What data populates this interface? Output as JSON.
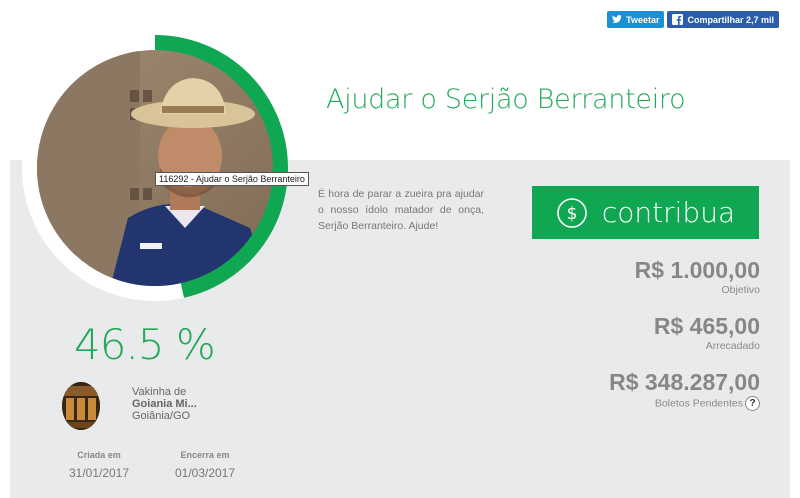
{
  "share": {
    "tweet_label": "Tweetar",
    "share_label": "Compartilhar 2,7 mil"
  },
  "campaign": {
    "title": "Ajudar o Serjão Berranteiro",
    "tooltip": "116292 - Ajudar o Serjão Berranteiro",
    "description": "É hora de parar a zueira pra ajudar o nosso ídolo matador de onça, Serjão Berranteiro. Ajude!",
    "contribute_label": "contribua",
    "progress_percent": 46.5,
    "percent_label": "46.5 %"
  },
  "stats": {
    "goal_amount": "R$ 1.000,00",
    "goal_label": "Objetivo",
    "raised_amount": "R$ 465,00",
    "raised_label": "Arrecadado",
    "pending_amount": "R$ 348.287,00",
    "pending_label": "Boletos Pendentes",
    "help": "?"
  },
  "owner": {
    "prefix": "Vakinha de",
    "name": "Goiania Mi...",
    "location": "Goiânia/GO"
  },
  "dates": {
    "created_label": "Criada em",
    "created_value": "31/01/2017",
    "ends_label": "Encerra em",
    "ends_value": "01/03/2017"
  },
  "colors": {
    "accent_green": "#24a859",
    "button_green": "#0fa751",
    "facebook_blue": "#2b5dab",
    "twitter_blue": "#1d8fd6",
    "panel_gray": "#e9eaeb"
  }
}
